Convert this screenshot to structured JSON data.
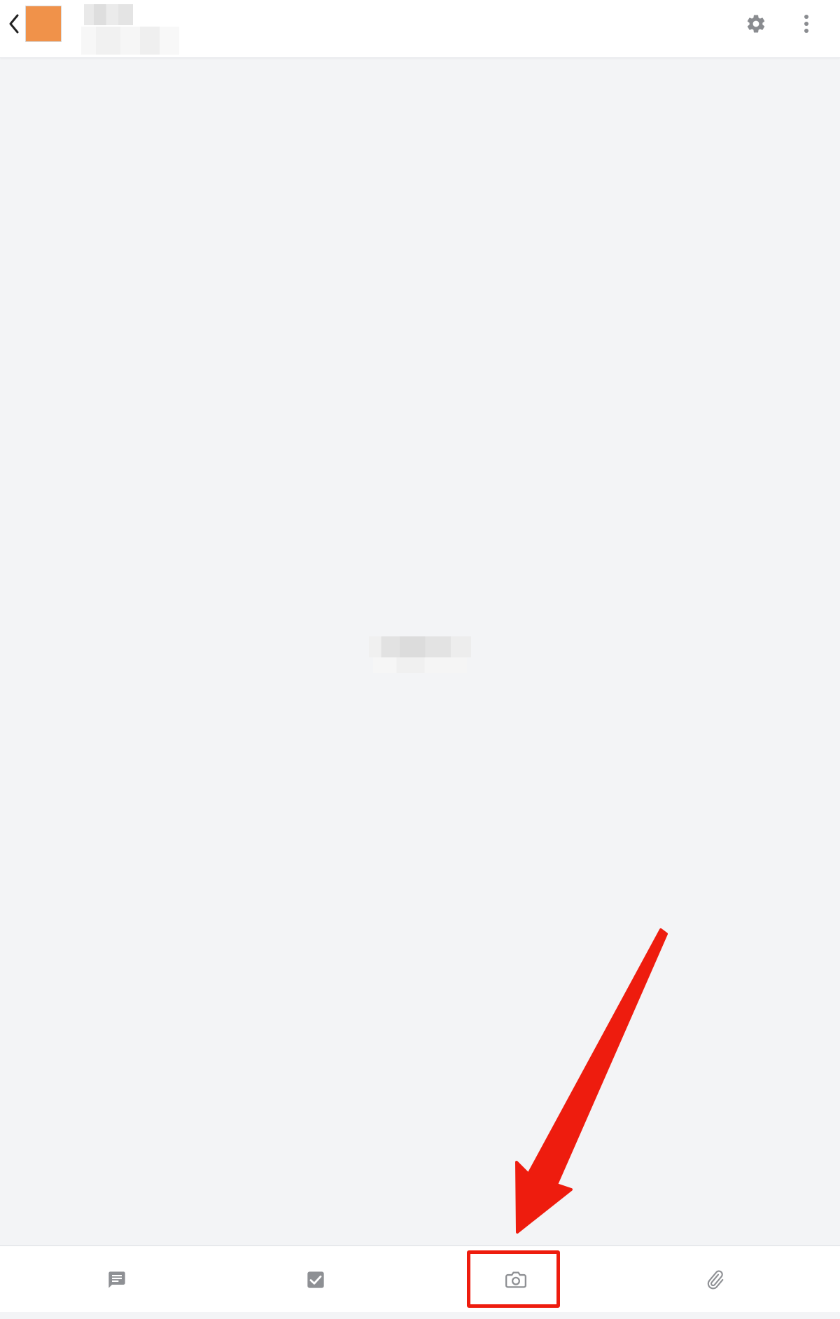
{
  "header": {
    "back_icon": "chevron-left-icon",
    "avatar_color": "#f0924a",
    "title": "",
    "subtitle": "",
    "settings_icon": "gear-icon",
    "more_icon": "more-vertical-icon"
  },
  "main": {
    "empty_state_text": "",
    "background": "#f3f4f6"
  },
  "toolbar": {
    "items": [
      {
        "icon": "comment-icon"
      },
      {
        "icon": "checkbox-icon"
      },
      {
        "icon": "camera-icon",
        "highlighted": true
      },
      {
        "icon": "paperclip-icon"
      }
    ],
    "icon_color": "#8e9094"
  },
  "annotation": {
    "color": "#ee1c0e",
    "target": "camera-icon"
  }
}
